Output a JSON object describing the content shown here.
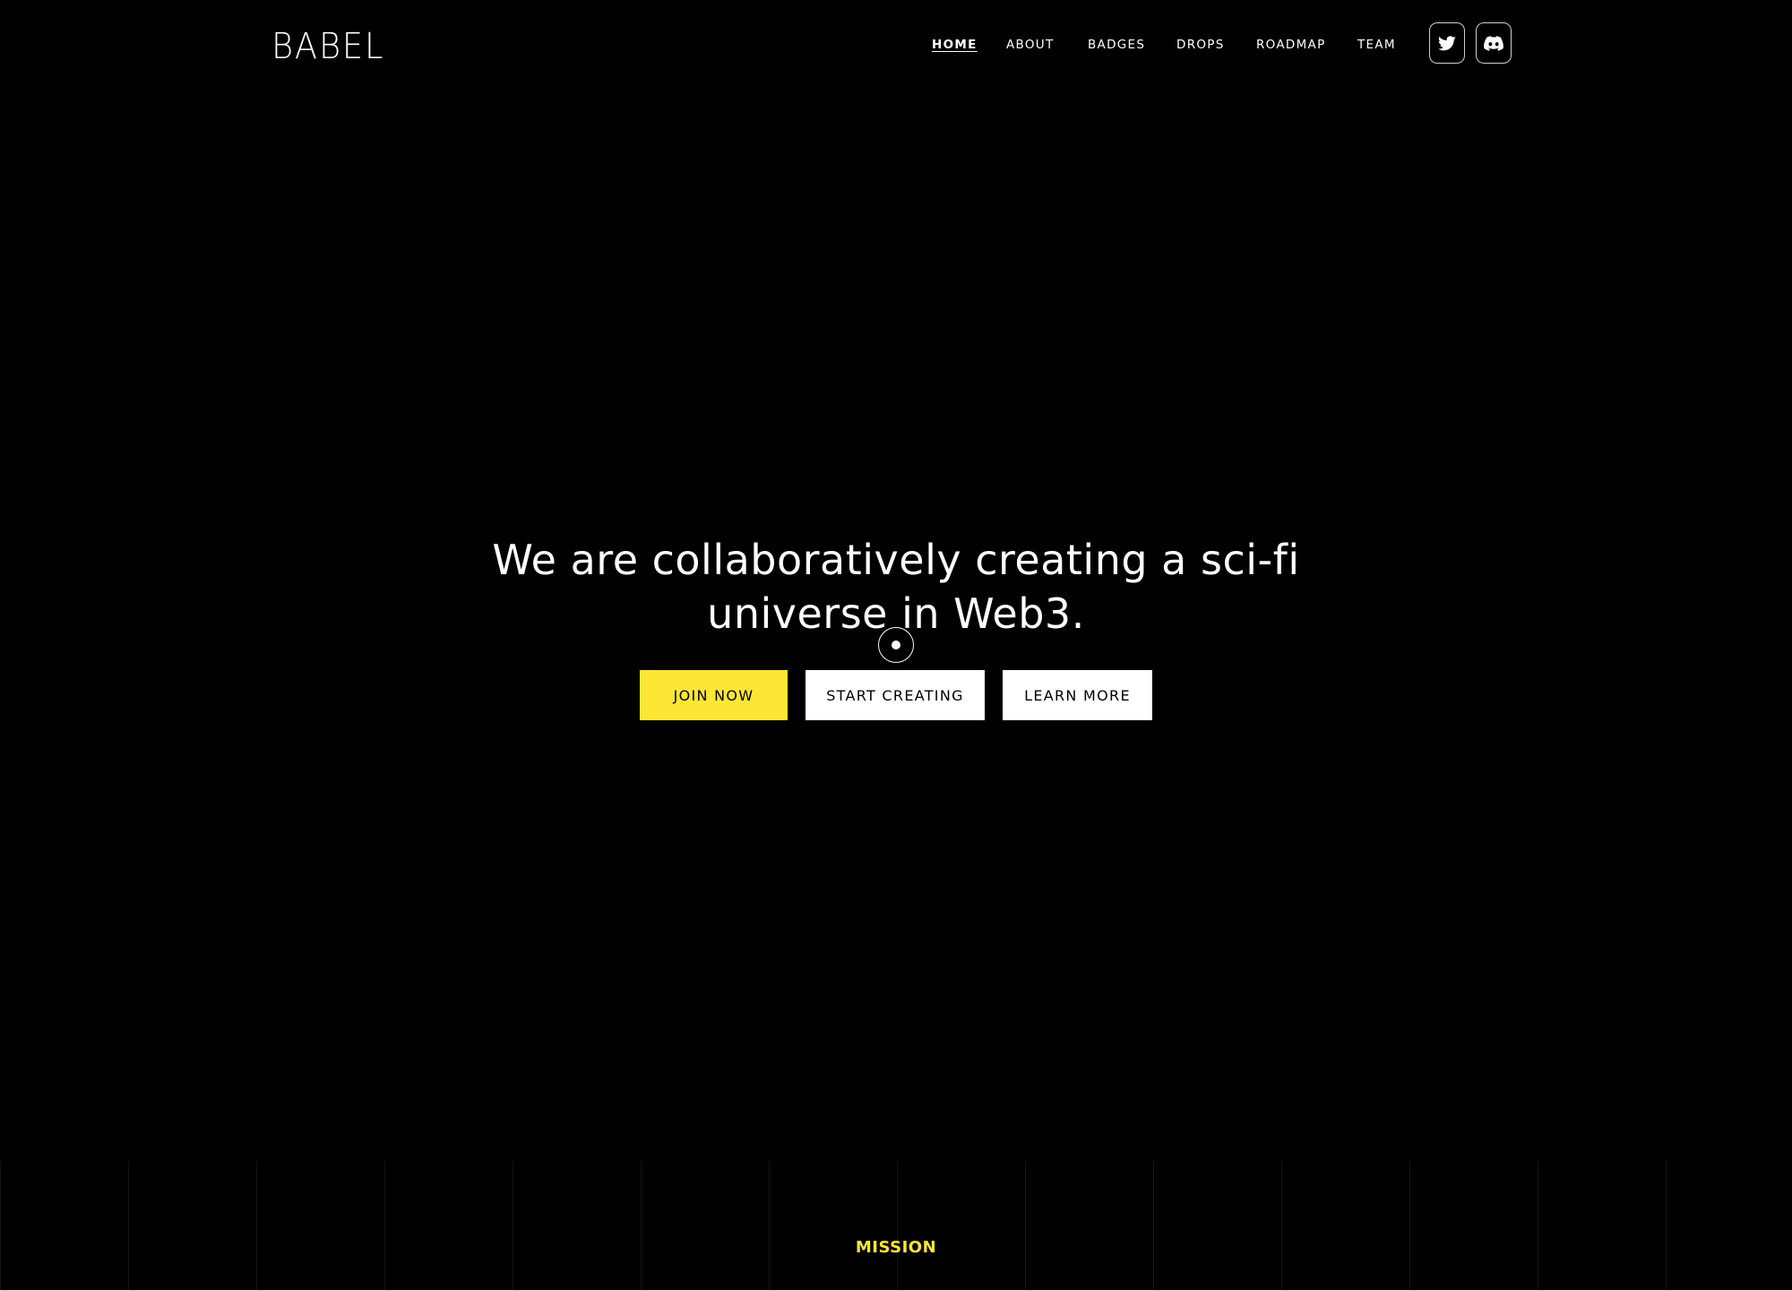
{
  "brand": {
    "logo_text": "BABEL"
  },
  "nav": {
    "items": [
      {
        "label": "HOME",
        "active": true
      },
      {
        "label": "ABOUT",
        "active": false
      },
      {
        "label": "BADGES",
        "active": false
      },
      {
        "label": "DROPS",
        "active": false
      },
      {
        "label": "ROADMAP",
        "active": false
      },
      {
        "label": "TEAM",
        "active": false
      }
    ],
    "social": [
      {
        "icon": "twitter-icon"
      },
      {
        "icon": "discord-icon"
      }
    ]
  },
  "hero": {
    "title": "We are collaboratively creating a sci-fi universe in Web3.",
    "buttons": {
      "join": "JOIN NOW",
      "create": "START CREATING",
      "learn": "LEARN MORE"
    }
  },
  "mission": {
    "label": "MISSION"
  },
  "colors": {
    "background": "#000000",
    "accent": "#fde635",
    "text": "#ffffff"
  }
}
